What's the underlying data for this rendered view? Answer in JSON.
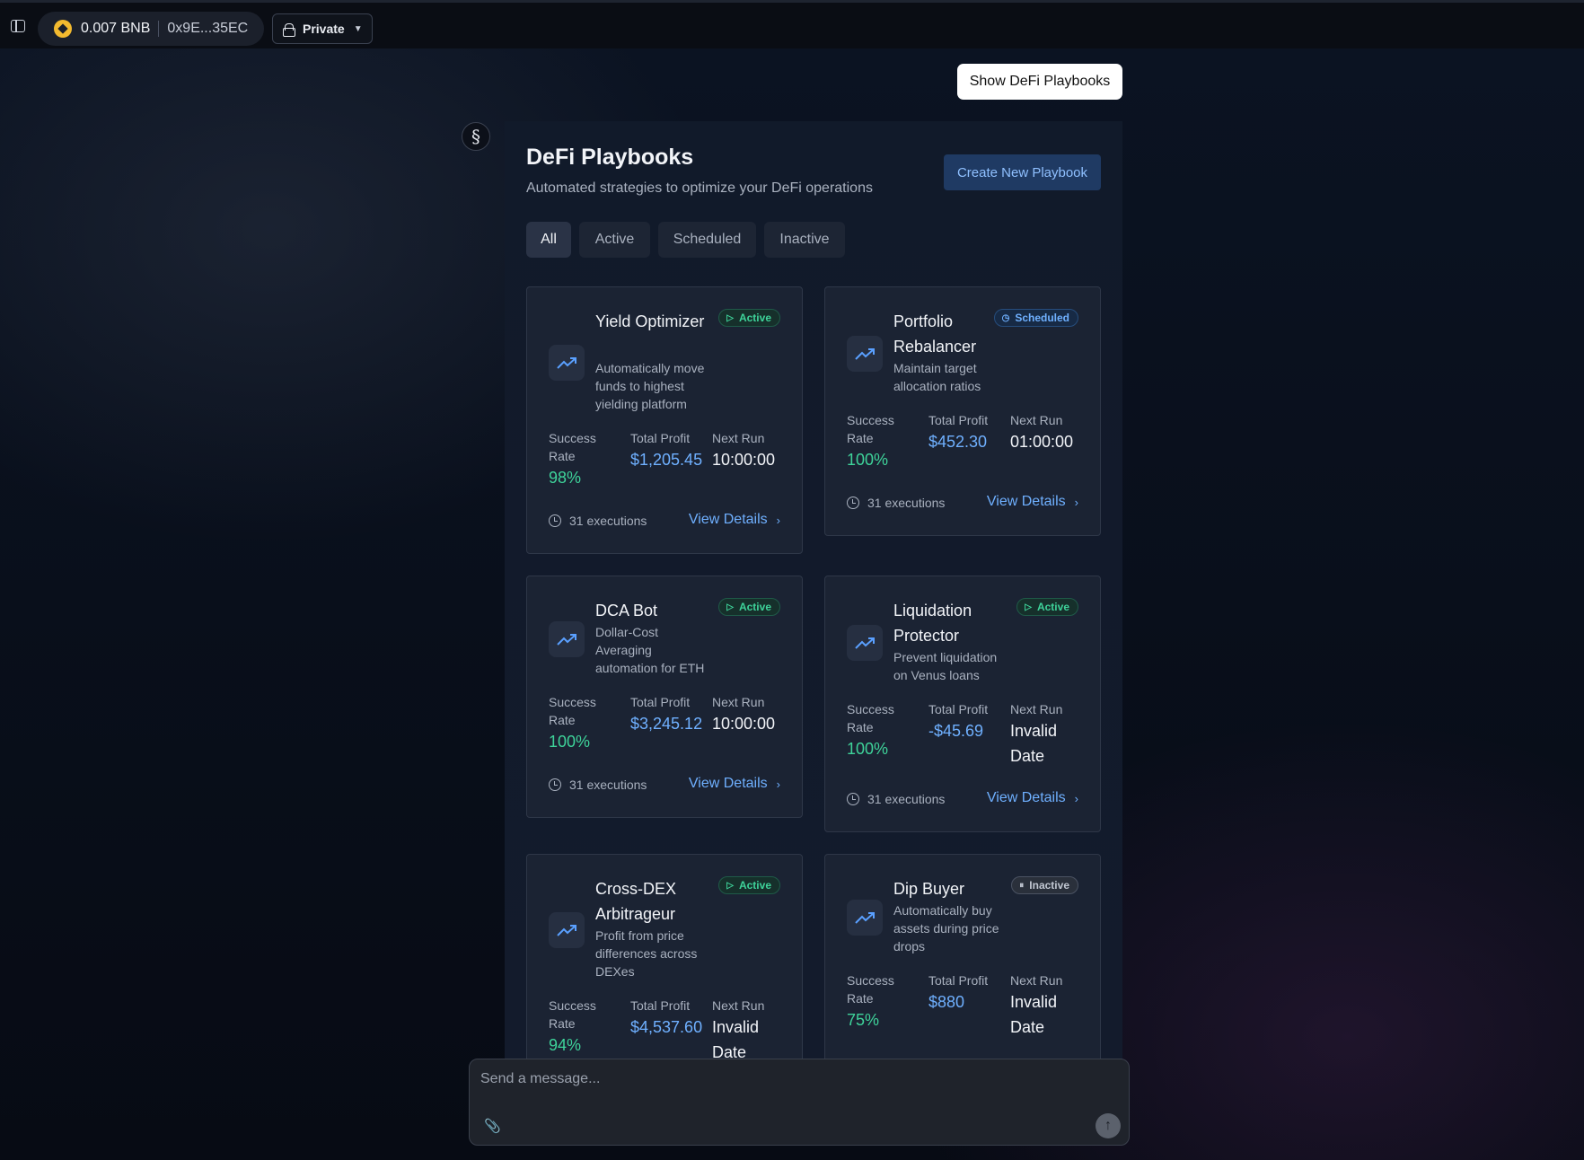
{
  "topbar": {
    "wallet_balance": "0.007 BNB",
    "wallet_address": "0x9E...35EC",
    "privacy_label": "Private"
  },
  "show_playbooks_label": "Show DeFi Playbooks",
  "panel": {
    "title": "DeFi Playbooks",
    "subtitle": "Automated strategies to optimize your DeFi operations",
    "create_label": "Create New Playbook",
    "tabs": [
      "All",
      "Active",
      "Scheduled",
      "Inactive"
    ]
  },
  "labels": {
    "success_rate": "Success Rate",
    "total_profit": "Total Profit",
    "next_run": "Next Run",
    "view_details": "View Details"
  },
  "cards": [
    {
      "name": "Yield Optimizer",
      "desc": "Automatically move funds to highest yielding platform",
      "status": "Active",
      "success": "98%",
      "profit": "$1,205.45",
      "next_run": "10:00:00",
      "executions": "31 executions"
    },
    {
      "name": "Portfolio Rebalancer",
      "desc": "Maintain target allocation ratios",
      "status": "Scheduled",
      "success": "100%",
      "profit": "$452.30",
      "next_run": "01:00:00",
      "executions": "31 executions"
    },
    {
      "name": "DCA Bot",
      "desc": "Dollar-Cost Averaging automation for ETH",
      "status": "Active",
      "success": "100%",
      "profit": "$3,245.12",
      "next_run": "10:00:00",
      "executions": "31 executions"
    },
    {
      "name": "Liquidation Protector",
      "desc": "Prevent liquidation on Venus loans",
      "status": "Active",
      "success": "100%",
      "profit": "-$45.69",
      "next_run": "Invalid Date",
      "executions": "31 executions"
    },
    {
      "name": "Cross-DEX Arbitrageur",
      "desc": "Profit from price differences across DEXes",
      "status": "Active",
      "success": "94%",
      "profit": "$4,537.60",
      "next_run": "Invalid Date",
      "executions": ""
    },
    {
      "name": "Dip Buyer",
      "desc": "Automatically buy assets during price drops",
      "status": "Inactive",
      "success": "75%",
      "profit": "$880",
      "next_run": "Invalid Date",
      "executions": ""
    }
  ],
  "composer": {
    "placeholder": "Send a message..."
  }
}
